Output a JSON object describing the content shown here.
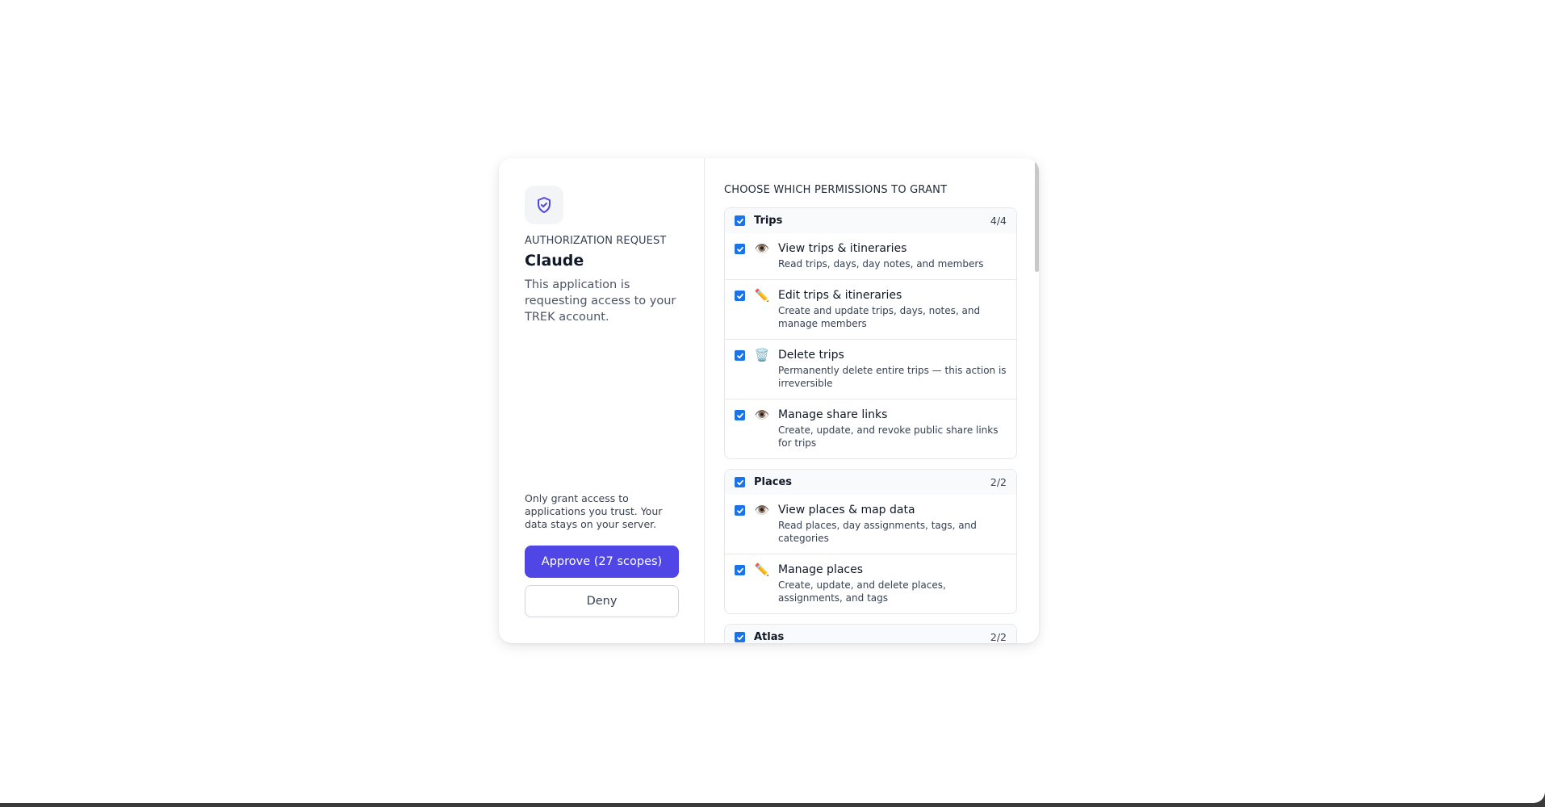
{
  "header": {
    "auth_label": "AUTHORIZATION REQUEST",
    "app_name": "Claude",
    "description": "This application is requesting access to your TREK account."
  },
  "footer": {
    "trust_note": "Only grant access to applications you trust. Your data stays on your server.",
    "approve_label": "Approve (27 scopes)",
    "deny_label": "Deny"
  },
  "permissions": {
    "section_title": "CHOOSE WHICH PERMISSIONS TO GRANT",
    "groups": [
      {
        "name": "Trips",
        "count": "4/4",
        "checked": true,
        "items": [
          {
            "icon": "eye-icon",
            "glyph": "👁️",
            "title": "View trips & itineraries",
            "desc": "Read trips, days, day notes, and members",
            "checked": true
          },
          {
            "icon": "pencil-icon",
            "glyph": "✏️",
            "title": "Edit trips & itineraries",
            "desc": "Create and update trips, days, notes, and manage members",
            "checked": true
          },
          {
            "icon": "trash-icon",
            "glyph": "🗑️",
            "title": "Delete trips",
            "desc": "Permanently delete entire trips — this action is irreversible",
            "checked": true
          },
          {
            "icon": "eye-icon",
            "glyph": "👁️",
            "title": "Manage share links",
            "desc": "Create, update, and revoke public share links for trips",
            "checked": true
          }
        ]
      },
      {
        "name": "Places",
        "count": "2/2",
        "checked": true,
        "items": [
          {
            "icon": "eye-icon",
            "glyph": "👁️",
            "title": "View places & map data",
            "desc": "Read places, day assignments, tags, and categories",
            "checked": true
          },
          {
            "icon": "pencil-icon",
            "glyph": "✏️",
            "title": "Manage places",
            "desc": "Create, update, and delete places, assignments, and tags",
            "checked": true
          }
        ]
      },
      {
        "name": "Atlas",
        "count": "2/2",
        "checked": true,
        "items": []
      }
    ]
  },
  "colors": {
    "accent": "#4f46e5",
    "checkbox": "#1a73e8",
    "shield_icon": "#4f46e5"
  }
}
